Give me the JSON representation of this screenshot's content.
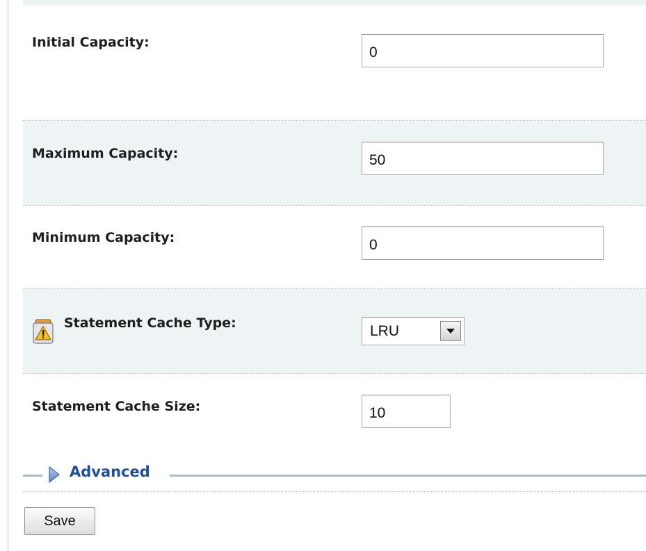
{
  "form": {
    "initial_capacity": {
      "label": "Initial Capacity:",
      "value": "0"
    },
    "maximum_capacity": {
      "label": "Maximum Capacity:",
      "value": "50"
    },
    "minimum_capacity": {
      "label": "Minimum Capacity:",
      "value": "0"
    },
    "statement_cache_type": {
      "label": "Statement Cache Type:",
      "value": "LRU",
      "icon": "warning-restart-icon"
    },
    "statement_cache_size": {
      "label": "Statement Cache Size:",
      "value": "10"
    }
  },
  "advanced": {
    "label": "Advanced",
    "icon": "expand-arrow-icon"
  },
  "actions": {
    "save_label": "Save"
  },
  "colors": {
    "row_shade": "#eef3f4",
    "link_blue": "#1d4d93",
    "divider_blue": "#a8bcd4"
  }
}
